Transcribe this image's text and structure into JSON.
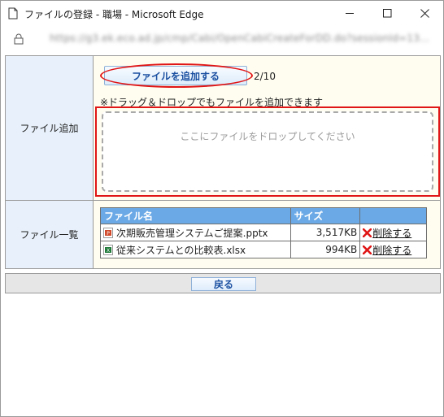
{
  "window": {
    "title": "ファイルの登録 - 職場 - Microsoft Edge",
    "url": "https://g3.ek.eco.ad.jp/cmp/Cabi/OpenCabiCreateForDD.do?sessionId=13..."
  },
  "form": {
    "add_label": "ファイル追加",
    "add_button": "ファイルを追加する",
    "count": "2/10",
    "dnd_note": "※ドラッグ＆ドロップでもファイルを追加できます",
    "drop_text": "ここにファイルをドロップしてください",
    "list_label": "ファイル一覧"
  },
  "files_table": {
    "headers": [
      "ファイル名",
      "サイズ",
      ""
    ],
    "rows": [
      {
        "name": "次期販売管理システムご提案.pptx",
        "size": "3,517KB",
        "delete": "削除する",
        "icon": "powerpoint-file-icon"
      },
      {
        "name": "従来システムとの比較表.xlsx",
        "size": "994KB",
        "delete": "削除する",
        "icon": "excel-file-icon"
      }
    ]
  },
  "footer": {
    "back_button": "戻る"
  },
  "colors": {
    "header_blue": "#6aa9e6",
    "highlight_red": "#e01515",
    "label_bg": "#e8f1fb",
    "cell_bg": "#fffdf0"
  }
}
